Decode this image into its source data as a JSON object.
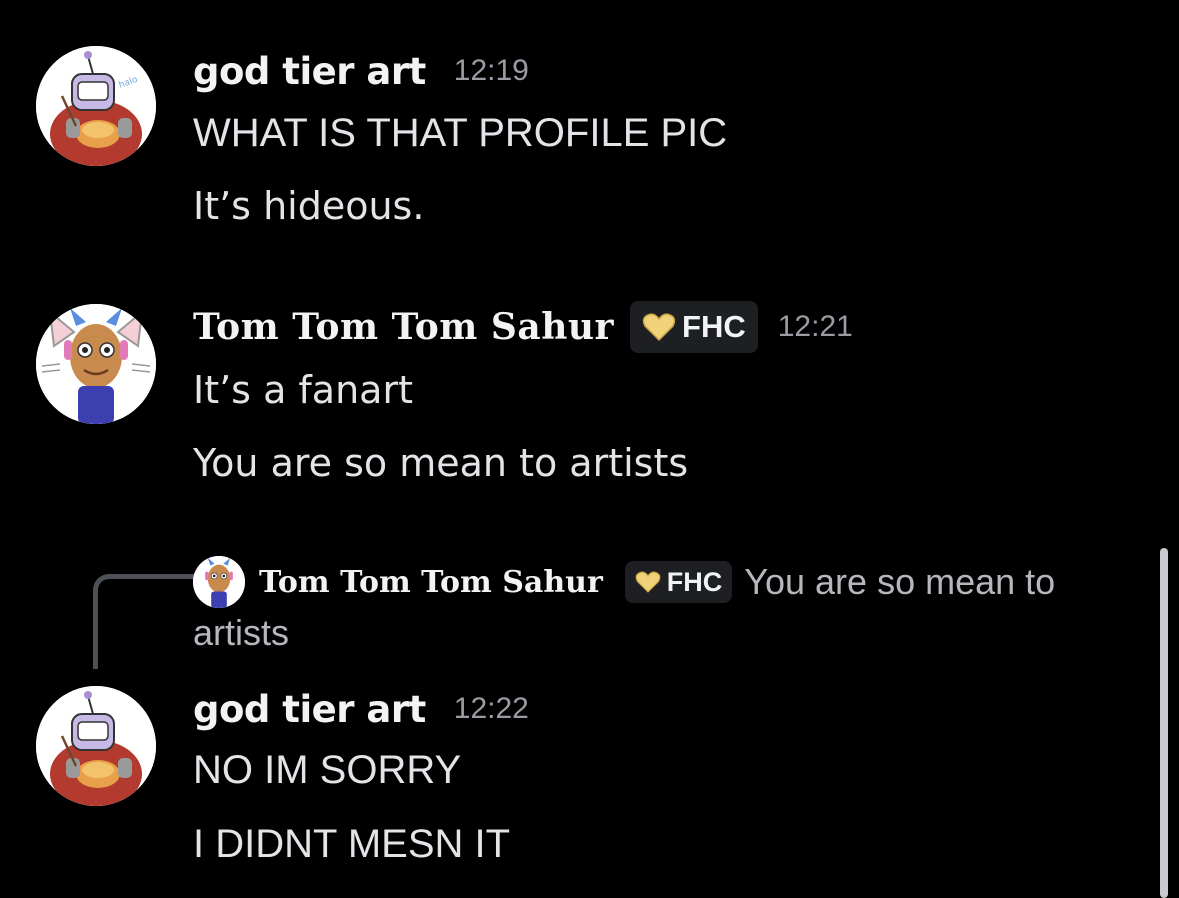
{
  "messages": [
    {
      "author": "god tier art",
      "timestamp": "12:19",
      "lines": [
        "WHAT IS THAT PROFILE PIC",
        "It’s hideous."
      ]
    },
    {
      "author": "Tom Tom Tom Sahur",
      "tag": "FHC",
      "timestamp": "12:21",
      "lines": [
        "It’s a fanart",
        "You are so mean to artists"
      ]
    },
    {
      "reply_to": {
        "author": "Tom Tom Tom Sahur",
        "tag": "FHC",
        "text_line1": "You are so mean to",
        "text_line2": "artists"
      },
      "author": "god tier art",
      "timestamp": "12:22",
      "lines": [
        "NO IM SORRY",
        "I DIDNT MESN IT"
      ]
    }
  ],
  "icons": {
    "tag_icon": "heart-icon",
    "avatar_1": "robot-avatar",
    "avatar_2": "cat-ear-face-avatar"
  },
  "colors": {
    "background": "#000000",
    "username": "#f2f3f5",
    "timestamp": "#9a9ca3",
    "tag_bg": "#1e1f22",
    "heart": "#f0d27a",
    "reply_text": "#b5b7bd"
  }
}
